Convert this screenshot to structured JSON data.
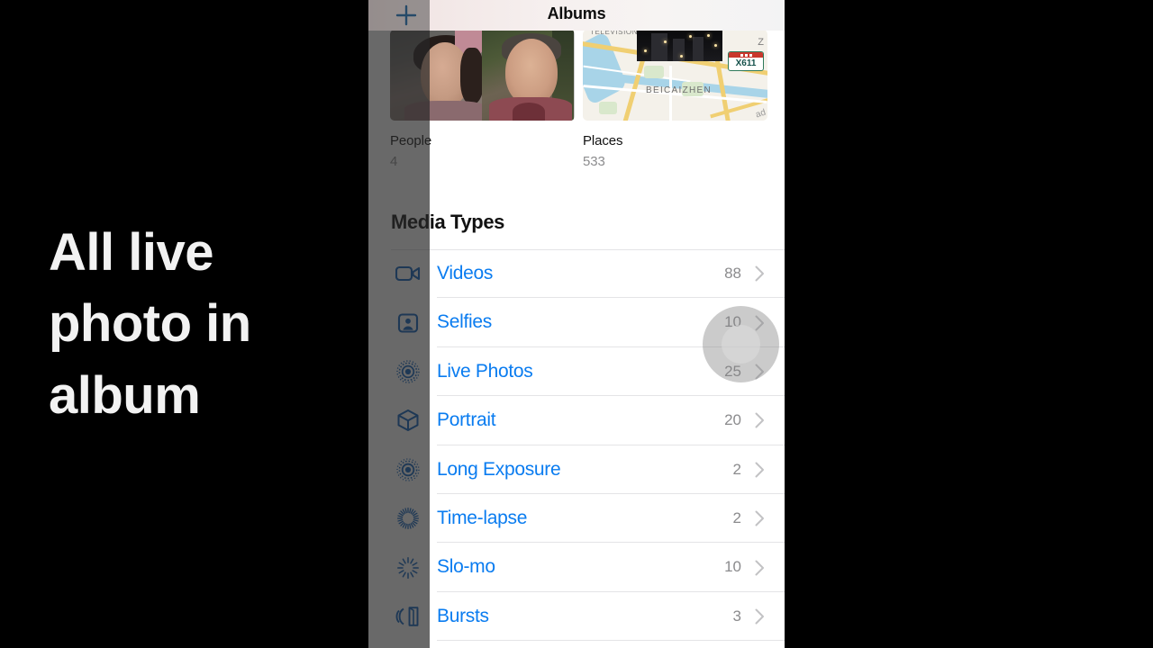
{
  "caption": {
    "text": "All live photo in album"
  },
  "phone": {
    "navbar": {
      "title": "Albums",
      "add_label": "+",
      "add_icon": "plus-icon"
    },
    "albums": [
      {
        "name": "People",
        "count": "4",
        "thumb": "people-faces"
      },
      {
        "name": "Places",
        "count": "533",
        "thumb": "map-preview"
      }
    ],
    "map_labels": {
      "tower": "TELEVISION TOWER",
      "district": "BEICAIZHEN",
      "shield": "X611",
      "edge_z": "Z",
      "road": "ad"
    },
    "section": {
      "title": "Media Types"
    },
    "media_types": [
      {
        "label": "Videos",
        "count": "88",
        "icon": "video-camera-icon",
        "chevron": "chevron-right-icon"
      },
      {
        "label": "Selfies",
        "count": "10",
        "icon": "selfie-person-icon",
        "chevron": "chevron-right-icon"
      },
      {
        "label": "Live Photos",
        "count": "25",
        "icon": "live-photo-icon",
        "chevron": "chevron-right-icon"
      },
      {
        "label": "Portrait",
        "count": "20",
        "icon": "cube-icon",
        "chevron": "chevron-right-icon"
      },
      {
        "label": "Long Exposure",
        "count": "2",
        "icon": "long-exposure-icon",
        "chevron": "chevron-right-icon"
      },
      {
        "label": "Time-lapse",
        "count": "2",
        "icon": "timelapse-icon",
        "chevron": "chevron-right-icon"
      },
      {
        "label": "Slo-mo",
        "count": "10",
        "icon": "slomo-icon",
        "chevron": "chevron-right-icon"
      },
      {
        "label": "Bursts",
        "count": "3",
        "icon": "bursts-stack-icon",
        "chevron": "chevron-right-icon"
      }
    ],
    "touch_indicator": {
      "name": "touch-point"
    }
  },
  "colors": {
    "accent_blue": "#0a7cf0",
    "count_gray": "#8b8b8d",
    "caption_white": "#f2f2f2",
    "background_black": "#000000",
    "separator": "#e4e4e6"
  }
}
